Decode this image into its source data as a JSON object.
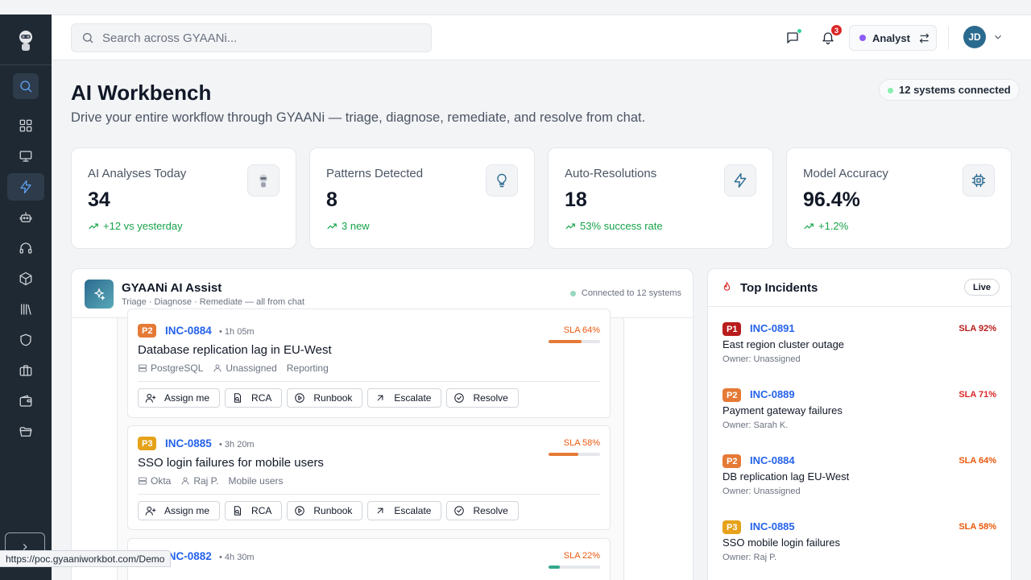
{
  "search": {
    "placeholder": "Search across GYAANi..."
  },
  "topbar": {
    "bell_count": "3",
    "role_label": "Analyst",
    "avatar_initials": "JD"
  },
  "page": {
    "title": "AI Workbench",
    "subtitle": "Drive your entire workflow through GYAANi — triage, diagnose, remediate, and resolve from chat.",
    "systems_badge": "12 systems connected"
  },
  "stats": [
    {
      "label": "AI Analyses Today",
      "value": "34",
      "delta": "+12 vs yesterday",
      "icon": "robot-icon"
    },
    {
      "label": "Patterns Detected",
      "value": "8",
      "delta": "3 new",
      "icon": "lightbulb-icon"
    },
    {
      "label": "Auto-Resolutions",
      "value": "18",
      "delta": "53% success rate",
      "icon": "lightning-icon"
    },
    {
      "label": "Model Accuracy",
      "value": "96.4%",
      "delta": "+1.2%",
      "icon": "cpu-icon"
    }
  ],
  "assist": {
    "title": "GYAANi AI Assist",
    "subtitle": "Triage · Diagnose · Remediate — all from chat",
    "connection": "Connected to 12 systems",
    "actions": [
      "Assign me",
      "RCA",
      "Runbook",
      "Escalate",
      "Resolve"
    ],
    "incidents": [
      {
        "priority": "P2",
        "id": "INC-0884",
        "age": "• 1h 05m",
        "title": "Database replication lag in EU-West",
        "system": "PostgreSQL",
        "owner": "Unassigned",
        "tag": "Reporting",
        "sla": "SLA 64%",
        "sla_value": 64
      },
      {
        "priority": "P3",
        "id": "INC-0885",
        "age": "• 3h 20m",
        "title": "SSO login failures for mobile users",
        "system": "Okta",
        "owner": "Raj P.",
        "tag": "Mobile users",
        "sla": "SLA 58%",
        "sla_value": 58
      },
      {
        "priority": "",
        "id": "INC-0882",
        "age": "• 4h 30m",
        "sla": "SLA 22%",
        "sla_value": 22
      }
    ]
  },
  "top_incidents": {
    "title": "Top Incidents",
    "live_label": "Live",
    "items": [
      {
        "priority": "P1",
        "id": "INC-0891",
        "sla": "SLA 92%",
        "sla_color": "#b91c1c",
        "title": "East region cluster outage",
        "owner": "Owner: Unassigned"
      },
      {
        "priority": "P2",
        "id": "INC-0889",
        "sla": "SLA 71%",
        "sla_color": "#dc2626",
        "title": "Payment gateway failures",
        "owner": "Owner: Sarah K."
      },
      {
        "priority": "P2",
        "id": "INC-0884",
        "sla": "SLA 64%",
        "sla_color": "#ea580c",
        "title": "DB replication lag EU-West",
        "owner": "Owner: Unassigned"
      },
      {
        "priority": "P3",
        "id": "INC-0885",
        "sla": "SLA 58%",
        "sla_color": "#ea580c",
        "title": "SSO mobile login failures",
        "owner": "Owner: Raj P."
      }
    ]
  },
  "statusbar": {
    "url": "https://poc.gyaaniworkbot.com/Demo"
  },
  "colors": {
    "accent": "#2b6a8f",
    "link": "#2563eb",
    "sidebar": "#1f2933",
    "success": "#16a34a"
  }
}
